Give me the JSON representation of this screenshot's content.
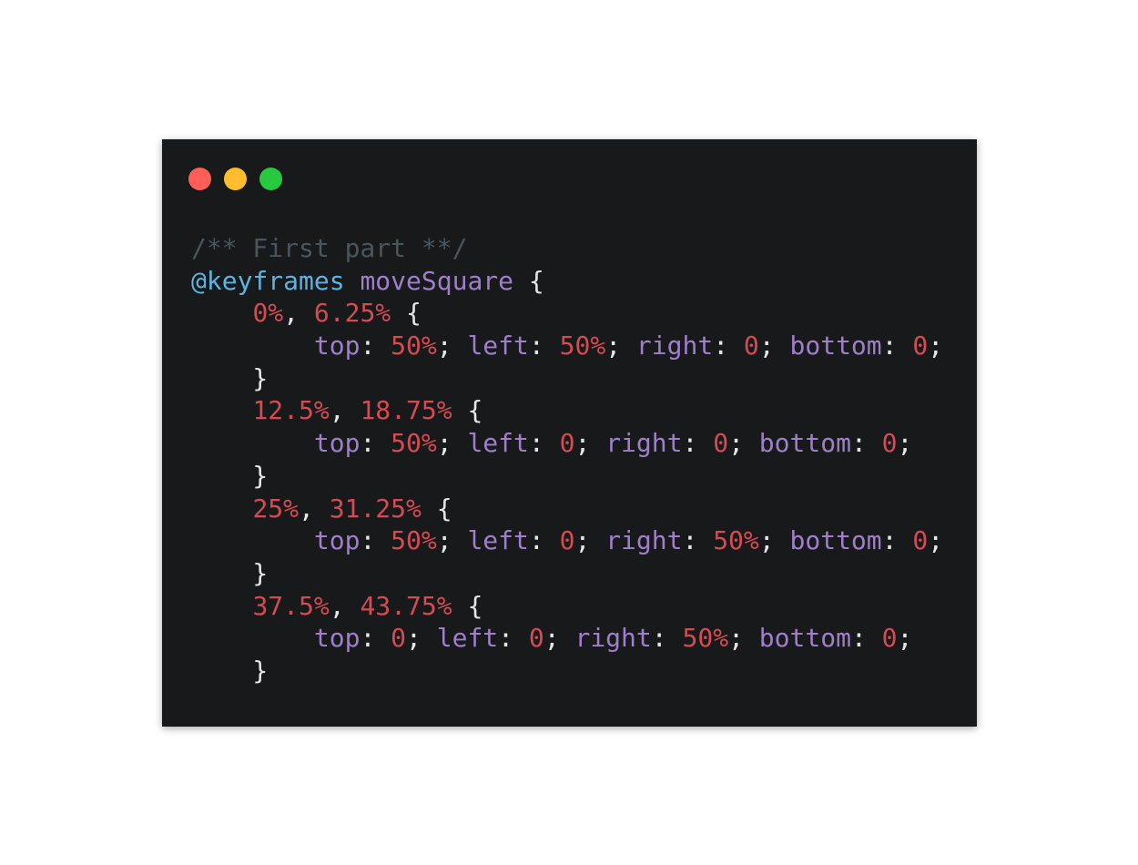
{
  "colors": {
    "background": "#18191b",
    "traffic_red": "#ff5f56",
    "traffic_yellow": "#ffbd2e",
    "traffic_green": "#27c93f",
    "comment": "#4a555c",
    "at_keyword": "#5eb3e0",
    "identifier": "#a07fca",
    "number": "#d54b52",
    "punctuation": "#e6e6e6"
  },
  "window": {
    "controls": [
      {
        "name": "close",
        "color": "#ff5f56"
      },
      {
        "name": "minimize",
        "color": "#ffbd2e"
      },
      {
        "name": "maximize",
        "color": "#27c93f"
      }
    ]
  },
  "code": {
    "language": "css",
    "lines": [
      [
        {
          "t": "/** First part **/",
          "k": "comment"
        }
      ],
      [
        {
          "t": "@keyframes",
          "k": "at_keyword"
        },
        {
          "t": " ",
          "k": "punctuation"
        },
        {
          "t": "moveSquare",
          "k": "identifier"
        },
        {
          "t": " {",
          "k": "punctuation"
        }
      ],
      [
        {
          "t": "    ",
          "k": "punctuation"
        },
        {
          "t": "0%",
          "k": "number"
        },
        {
          "t": ", ",
          "k": "punctuation"
        },
        {
          "t": "6.25%",
          "k": "number"
        },
        {
          "t": " {",
          "k": "punctuation"
        }
      ],
      [
        {
          "t": "        ",
          "k": "punctuation"
        },
        {
          "t": "top",
          "k": "identifier"
        },
        {
          "t": ": ",
          "k": "punctuation"
        },
        {
          "t": "50%",
          "k": "number"
        },
        {
          "t": "; ",
          "k": "punctuation"
        },
        {
          "t": "left",
          "k": "identifier"
        },
        {
          "t": ": ",
          "k": "punctuation"
        },
        {
          "t": "50%",
          "k": "number"
        },
        {
          "t": "; ",
          "k": "punctuation"
        },
        {
          "t": "right",
          "k": "identifier"
        },
        {
          "t": ": ",
          "k": "punctuation"
        },
        {
          "t": "0",
          "k": "number"
        },
        {
          "t": "; ",
          "k": "punctuation"
        },
        {
          "t": "bottom",
          "k": "identifier"
        },
        {
          "t": ": ",
          "k": "punctuation"
        },
        {
          "t": "0",
          "k": "number"
        },
        {
          "t": ";",
          "k": "punctuation"
        }
      ],
      [
        {
          "t": "    }",
          "k": "punctuation"
        }
      ],
      [
        {
          "t": "    ",
          "k": "punctuation"
        },
        {
          "t": "12.5%",
          "k": "number"
        },
        {
          "t": ", ",
          "k": "punctuation"
        },
        {
          "t": "18.75%",
          "k": "number"
        },
        {
          "t": " {",
          "k": "punctuation"
        }
      ],
      [
        {
          "t": "        ",
          "k": "punctuation"
        },
        {
          "t": "top",
          "k": "identifier"
        },
        {
          "t": ": ",
          "k": "punctuation"
        },
        {
          "t": "50%",
          "k": "number"
        },
        {
          "t": "; ",
          "k": "punctuation"
        },
        {
          "t": "left",
          "k": "identifier"
        },
        {
          "t": ": ",
          "k": "punctuation"
        },
        {
          "t": "0",
          "k": "number"
        },
        {
          "t": "; ",
          "k": "punctuation"
        },
        {
          "t": "right",
          "k": "identifier"
        },
        {
          "t": ": ",
          "k": "punctuation"
        },
        {
          "t": "0",
          "k": "number"
        },
        {
          "t": "; ",
          "k": "punctuation"
        },
        {
          "t": "bottom",
          "k": "identifier"
        },
        {
          "t": ": ",
          "k": "punctuation"
        },
        {
          "t": "0",
          "k": "number"
        },
        {
          "t": ";",
          "k": "punctuation"
        }
      ],
      [
        {
          "t": "    }",
          "k": "punctuation"
        }
      ],
      [
        {
          "t": "    ",
          "k": "punctuation"
        },
        {
          "t": "25%",
          "k": "number"
        },
        {
          "t": ", ",
          "k": "punctuation"
        },
        {
          "t": "31.25%",
          "k": "number"
        },
        {
          "t": " {",
          "k": "punctuation"
        }
      ],
      [
        {
          "t": "        ",
          "k": "punctuation"
        },
        {
          "t": "top",
          "k": "identifier"
        },
        {
          "t": ": ",
          "k": "punctuation"
        },
        {
          "t": "50%",
          "k": "number"
        },
        {
          "t": "; ",
          "k": "punctuation"
        },
        {
          "t": "left",
          "k": "identifier"
        },
        {
          "t": ": ",
          "k": "punctuation"
        },
        {
          "t": "0",
          "k": "number"
        },
        {
          "t": "; ",
          "k": "punctuation"
        },
        {
          "t": "right",
          "k": "identifier"
        },
        {
          "t": ": ",
          "k": "punctuation"
        },
        {
          "t": "50%",
          "k": "number"
        },
        {
          "t": "; ",
          "k": "punctuation"
        },
        {
          "t": "bottom",
          "k": "identifier"
        },
        {
          "t": ": ",
          "k": "punctuation"
        },
        {
          "t": "0",
          "k": "number"
        },
        {
          "t": ";",
          "k": "punctuation"
        }
      ],
      [
        {
          "t": "    }",
          "k": "punctuation"
        }
      ],
      [
        {
          "t": "    ",
          "k": "punctuation"
        },
        {
          "t": "37.5%",
          "k": "number"
        },
        {
          "t": ", ",
          "k": "punctuation"
        },
        {
          "t": "43.75%",
          "k": "number"
        },
        {
          "t": " {",
          "k": "punctuation"
        }
      ],
      [
        {
          "t": "        ",
          "k": "punctuation"
        },
        {
          "t": "top",
          "k": "identifier"
        },
        {
          "t": ": ",
          "k": "punctuation"
        },
        {
          "t": "0",
          "k": "number"
        },
        {
          "t": "; ",
          "k": "punctuation"
        },
        {
          "t": "left",
          "k": "identifier"
        },
        {
          "t": ": ",
          "k": "punctuation"
        },
        {
          "t": "0",
          "k": "number"
        },
        {
          "t": "; ",
          "k": "punctuation"
        },
        {
          "t": "right",
          "k": "identifier"
        },
        {
          "t": ": ",
          "k": "punctuation"
        },
        {
          "t": "50%",
          "k": "number"
        },
        {
          "t": "; ",
          "k": "punctuation"
        },
        {
          "t": "bottom",
          "k": "identifier"
        },
        {
          "t": ": ",
          "k": "punctuation"
        },
        {
          "t": "0",
          "k": "number"
        },
        {
          "t": ";",
          "k": "punctuation"
        }
      ],
      [
        {
          "t": "    }",
          "k": "punctuation"
        }
      ]
    ]
  }
}
